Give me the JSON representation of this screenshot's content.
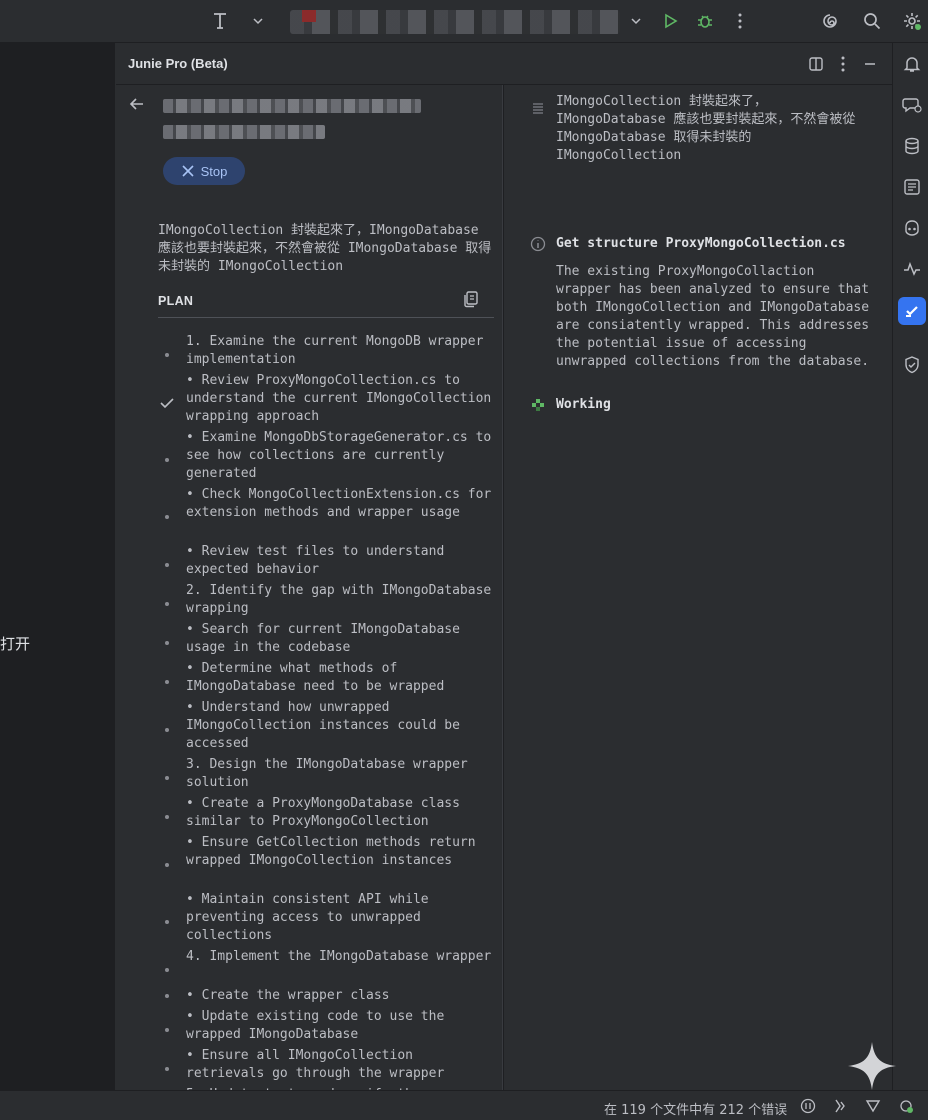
{
  "left_strip_text": "打开",
  "panel": {
    "title": "Junie Pro (Beta)"
  },
  "task": {
    "stop_label": "Stop",
    "description": "IMongoCollection 封裝起來了，IMongoDatabase 應該也要封裝起來，不然會被從 IMongoDatabase 取得未封裝的 IMongoCollection"
  },
  "plan": {
    "label": "PLAN",
    "items": [
      {
        "text": "1. Examine the current MongoDB wrapper implementation",
        "status": "pending"
      },
      {
        "text": "• Review ProxyMongoCollection.cs to understand the current IMongoCollection wrapping approach",
        "status": "done"
      },
      {
        "text": "• Examine MongoDbStorageGenerator.cs to see how collections are currently generated",
        "status": "pending"
      },
      {
        "text": "• Check MongoCollectionExtension.cs for extension methods and wrapper usage",
        "status": "pending"
      },
      {
        "text": "• Review test files to understand expected behavior",
        "status": "pending"
      },
      {
        "text": "2. Identify the gap with IMongoDatabase wrapping",
        "status": "pending"
      },
      {
        "text": "• Search for current IMongoDatabase usage in the codebase",
        "status": "pending"
      },
      {
        "text": "• Determine what methods of IMongoDatabase need to be wrapped",
        "status": "pending"
      },
      {
        "text": "• Understand how unwrapped IMongoCollection instances could be accessed",
        "status": "pending"
      },
      {
        "text": "3. Design the IMongoDatabase wrapper solution",
        "status": "pending"
      },
      {
        "text": "• Create a ProxyMongoDatabase class similar to ProxyMongoCollection",
        "status": "pending"
      },
      {
        "text": "• Ensure GetCollection methods return wrapped IMongoCollection instances",
        "status": "pending"
      },
      {
        "text": "• Maintain consistent API while preventing access to unwrapped collections",
        "status": "pending"
      },
      {
        "text": "4. Implement the IMongoDatabase wrapper",
        "status": "pending"
      },
      {
        "text": "• Create the wrapper class",
        "status": "pending"
      },
      {
        "text": "• Update existing code to use the wrapped IMongoDatabase",
        "status": "pending"
      },
      {
        "text": "• Ensure all IMongoCollection retrievals go through the wrapper",
        "status": "pending"
      },
      {
        "text": "5. Update tests and verify the",
        "status": "pending"
      }
    ]
  },
  "log": {
    "message_text": "IMongoCollection 封裝起來了，IMongoDatabase 應該也要封裝起來，不然會被從 IMongoDatabase 取得未封裝的 IMongoCollection",
    "step_title": "Get structure ProxyMongoCollection.cs",
    "step_body": "The existing ProxyMongoCollaction wrapper has been analyzed to ensure that both IMongoCollection and IMongoDatabase are consiatently wrapped. This addresses the potential issue of accessing unwrapped collections from the database.",
    "working_label": "Working"
  },
  "status_bar": {
    "text": "在 119 个文件中有 212 个错误"
  },
  "icons": {
    "top": [
      "text-cursor-icon",
      "chevron-down-icon",
      "run-icon",
      "debug-icon",
      "more-vert-icon",
      "swirl-icon",
      "search-icon",
      "settings-icon"
    ],
    "tool_strip": [
      "bell-icon",
      "ai-chat-icon",
      "database-icon",
      "checklist-icon",
      "copilot-icon",
      "pulse-icon",
      "junie-icon",
      "shield-icon"
    ]
  },
  "colors": {
    "accent": "#3574f0",
    "run_green": "#5fb865",
    "working_green": "#5fb865",
    "stop_bg": "#2e436e"
  }
}
